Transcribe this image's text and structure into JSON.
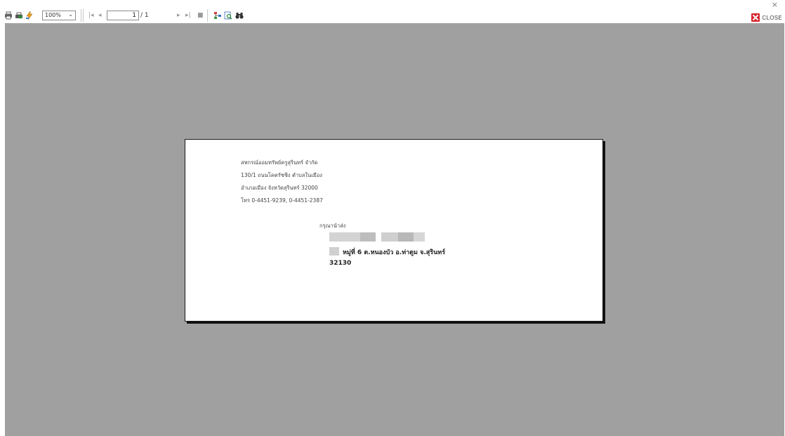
{
  "toolbar": {
    "zoom": "100%",
    "current_page": "1",
    "total_pages": "/ 1",
    "close_label": "CLOSE",
    "window_close_glyph": "×"
  },
  "icons": {
    "print": "print-icon",
    "print_setup": "printer-setup-icon",
    "export": "export-icon",
    "first": "first-page-icon",
    "prev": "previous-page-icon",
    "next": "next-page-icon",
    "last": "last-page-icon",
    "stop": "stop-icon",
    "group_tree": "group-tree-icon",
    "search_report": "search-report-icon",
    "find": "binoculars-icon"
  },
  "document": {
    "sender": {
      "line1": "สหกรณ์ออมทรัพย์ครูสุรินทร์ จำกัด",
      "line2": "130/1 ถนนโคตรัชชิง ตำบลในเมือง",
      "line3": "อำเภอเมือง จังหวัดสุรินทร์ 32000",
      "line4": "โทร 0-4451-9239, 0-4451-2387"
    },
    "recipient_label": "กรุณานำส่ง",
    "address_line": "หมู่ที่ 6 ต.หนองบัว อ.ท่าตูม จ.สุรินทร์",
    "postcode": "32130"
  },
  "colors": {
    "preview_background": "#a0a0a0",
    "close_icon": "#d6262e"
  }
}
